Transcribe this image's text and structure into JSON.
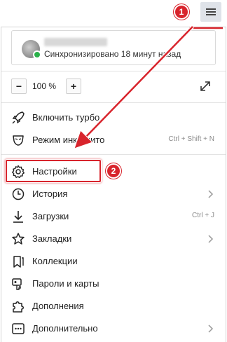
{
  "account": {
    "status": "Синхронизировано 18 минут назад"
  },
  "zoom": {
    "minus": "−",
    "value": "100 %",
    "plus": "+"
  },
  "menu": {
    "turbo": "Включить турбо",
    "incognito": "Режим инкогнито",
    "incognito_shortcut": "Ctrl + Shift + N",
    "settings": "Настройки",
    "history": "История",
    "downloads": "Загрузки",
    "downloads_shortcut": "Ctrl + J",
    "bookmarks": "Закладки",
    "collections": "Коллекции",
    "passwords": "Пароли и карты",
    "extensions": "Дополнения",
    "more": "Дополнительно"
  },
  "annotations": {
    "step1": "1",
    "step2": "2"
  },
  "colors": {
    "accent": "#d8242c",
    "sync": "#2ab14a"
  }
}
